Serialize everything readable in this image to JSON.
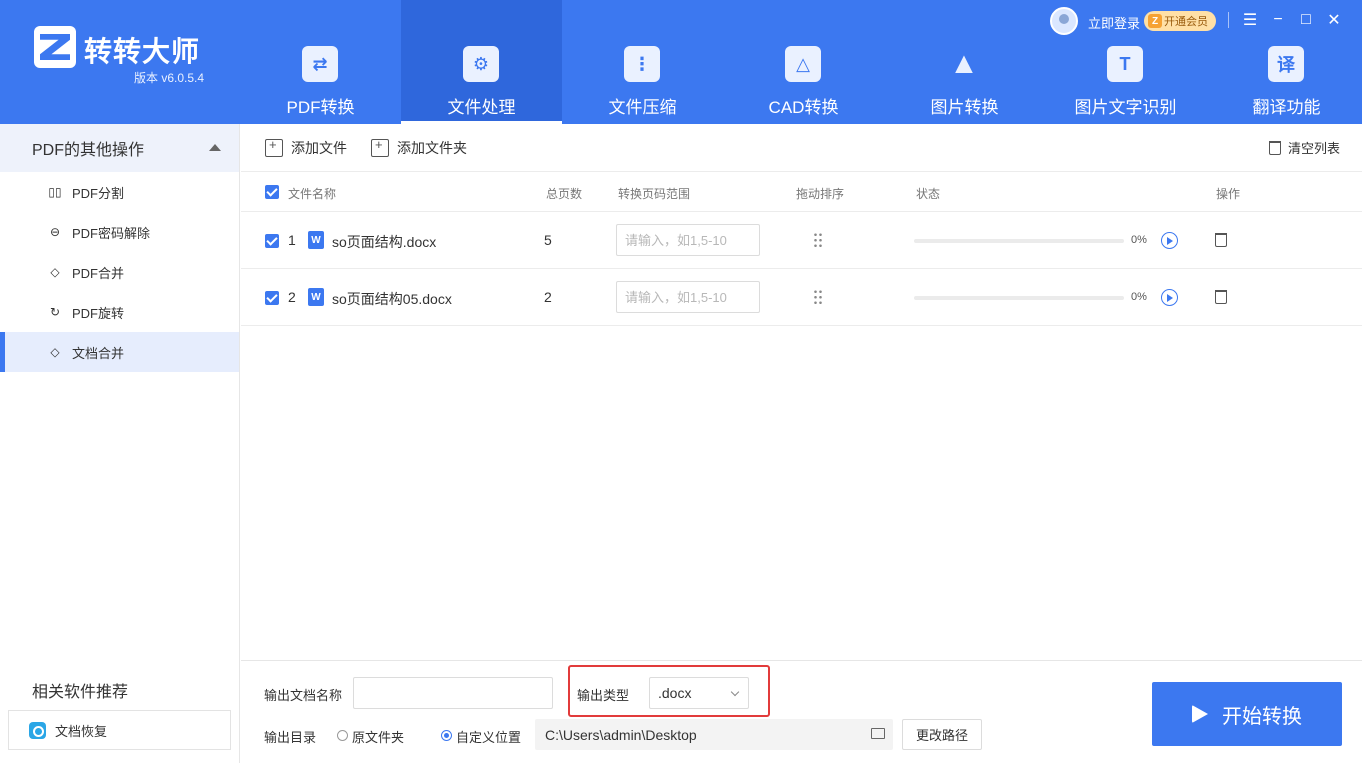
{
  "app": {
    "title": "转转大师",
    "version": "版本 v6.0.5.4",
    "brand_color": "#3c78f0"
  },
  "nav": [
    {
      "label": "PDF转换",
      "icon": "pdf-convert-icon",
      "active": false
    },
    {
      "label": "文件处理",
      "icon": "file-process-icon",
      "active": true
    },
    {
      "label": "文件压缩",
      "icon": "zip-icon",
      "active": false
    },
    {
      "label": "CAD转换",
      "icon": "cad-icon",
      "active": false
    },
    {
      "label": "图片转换",
      "icon": "image-icon",
      "active": false
    },
    {
      "label": "图片文字识别",
      "icon": "ocr-icon",
      "glyph": "T",
      "active": false
    },
    {
      "label": "翻译功能",
      "icon": "translate-icon",
      "glyph": "译",
      "active": false
    }
  ],
  "topbar": {
    "login": "立即登录",
    "vip": "开通会员"
  },
  "sidebar": {
    "section": "PDF的其他操作",
    "items": [
      {
        "label": "PDF分割",
        "icon": "split-icon"
      },
      {
        "label": "PDF密码解除",
        "icon": "unlock-icon"
      },
      {
        "label": "PDF合并",
        "icon": "merge-icon"
      },
      {
        "label": "PDF旋转",
        "icon": "rotate-icon"
      },
      {
        "label": "文档合并",
        "icon": "doc-merge-icon",
        "active": true
      }
    ],
    "recommend_title": "相关软件推荐",
    "recommend_item": "文档恢复"
  },
  "toolbar": {
    "add_file": "添加文件",
    "add_folder": "添加文件夹",
    "clear": "清空列表"
  },
  "table": {
    "headers": {
      "name": "文件名称",
      "pages": "总页数",
      "range": "转换页码范围",
      "sort": "拖动排序",
      "status": "状态",
      "action": "操作"
    },
    "range_placeholder": "请输入，如1,5-10",
    "rows": [
      {
        "index": "1",
        "name": "so页面结构.docx",
        "pages": "5",
        "progress": "0%"
      },
      {
        "index": "2",
        "name": "so页面结构05.docx",
        "pages": "2",
        "progress": "0%"
      }
    ]
  },
  "bottom": {
    "output_name_label": "输出文档名称",
    "output_name_value": "",
    "output_type_label": "输出类型",
    "output_type_value": ".docx",
    "output_dir_label": "输出目录",
    "radio_original": "原文件夹",
    "radio_custom": "自定义位置",
    "path": "C:\\Users\\admin\\Desktop",
    "change_path": "更改路径",
    "start": "开始转换"
  }
}
